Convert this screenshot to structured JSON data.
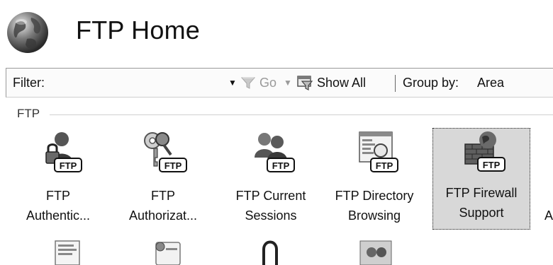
{
  "header": {
    "title": "FTP Home"
  },
  "toolbar": {
    "filter_label": "Filter:",
    "filter_value": "",
    "go_label": "Go",
    "show_all_label": "Show All",
    "group_by_label": "Group by:",
    "group_by_value": "Area"
  },
  "group": {
    "label": "FTP"
  },
  "features": [
    {
      "label": "FTP\nAuthentic...",
      "icon": "ftp-authentication-icon"
    },
    {
      "label": "FTP\nAuthorizat...",
      "icon": "ftp-authorization-icon"
    },
    {
      "label": "FTP Current\nSessions",
      "icon": "ftp-current-sessions-icon"
    },
    {
      "label": "FTP Directory\nBrowsing",
      "icon": "ftp-directory-browsing-icon"
    },
    {
      "label": "FTP Firewall\nSupport",
      "icon": "ftp-firewall-support-icon",
      "selected": true
    },
    {
      "label": "A",
      "icon": ""
    }
  ],
  "badge_text": "FTP",
  "colors": {
    "background": "#ffffff",
    "selected_tile": "#d8d8d8",
    "disabled_text": "#9a9a9a"
  }
}
